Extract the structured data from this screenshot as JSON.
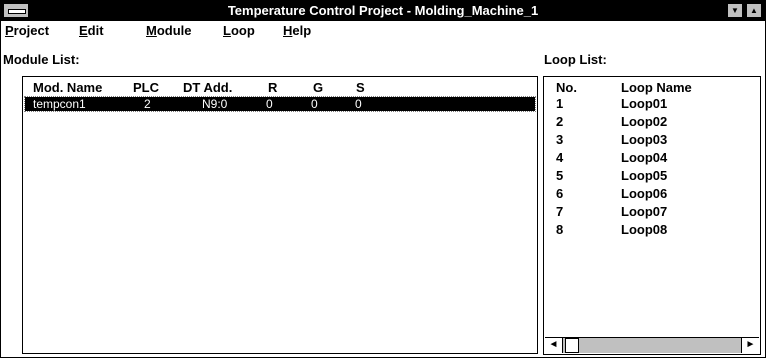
{
  "window": {
    "title": "Temperature Control Project - Molding_Machine_1"
  },
  "menu": [
    {
      "label": "Project",
      "hotkey": "P",
      "rest": "roject"
    },
    {
      "label": "Edit",
      "hotkey": "E",
      "rest": "dit"
    },
    {
      "label": "Module",
      "hotkey": "M",
      "rest": "odule"
    },
    {
      "label": "Loop",
      "hotkey": "L",
      "rest": "oop"
    },
    {
      "label": "Help",
      "hotkey": "H",
      "rest": "elp"
    }
  ],
  "module_list": {
    "label": "Module List:",
    "columns": [
      "Mod. Name",
      "PLC",
      "DT Add.",
      "R",
      "G",
      "S"
    ],
    "rows": [
      {
        "name": "tempcon1",
        "plc": "2",
        "dt_add": "N9:0",
        "r": "0",
        "g": "0",
        "s": "0",
        "selected": true
      }
    ]
  },
  "loop_list": {
    "label": "Loop List:",
    "columns": [
      "No.",
      "Loop Name"
    ],
    "rows": [
      {
        "no": "1",
        "name": "Loop01"
      },
      {
        "no": "2",
        "name": "Loop02"
      },
      {
        "no": "3",
        "name": "Loop03"
      },
      {
        "no": "4",
        "name": "Loop04"
      },
      {
        "no": "5",
        "name": "Loop05"
      },
      {
        "no": "6",
        "name": "Loop06"
      },
      {
        "no": "7",
        "name": "Loop07"
      },
      {
        "no": "8",
        "name": "Loop08"
      }
    ]
  },
  "icons": {
    "system_menu": "system-menu-icon",
    "minimize": "▼",
    "maximize": "▲",
    "scroll_left": "◄",
    "scroll_right": "►"
  }
}
